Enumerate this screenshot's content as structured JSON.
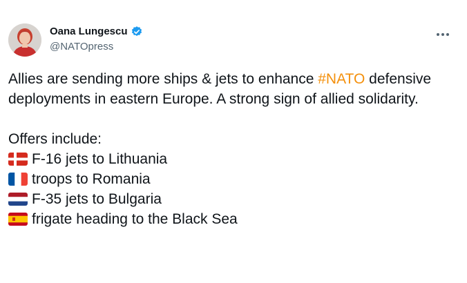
{
  "author": {
    "name": "Oana Lungescu",
    "handle": "@NATOpress",
    "verified": true,
    "avatar_icon": "profile-photo-avatar"
  },
  "menu": {
    "icon": "more-options-icon"
  },
  "tweet": {
    "text_before_hashtag": "Allies are sending more ships & jets to enhance ",
    "hashtag": "#NATO",
    "hashtag_color": "#f4900c",
    "text_after_hashtag": " defensive deployments in eastern Europe. A strong sign of allied solidarity.",
    "offers_heading": "Offers include:",
    "offers": [
      {
        "flag": "denmark-flag-icon",
        "text": "F-16 jets to Lithuania"
      },
      {
        "flag": "france-flag-icon",
        "text": "troops to Romania"
      },
      {
        "flag": "netherlands-flag-icon",
        "text": "F-35 jets to Bulgaria"
      },
      {
        "flag": "spain-flag-icon",
        "text": "frigate heading to the Black Sea"
      }
    ]
  },
  "colors": {
    "text": "#0f1419",
    "secondary_text": "#536471",
    "verified_badge": "#1d9bf0"
  }
}
